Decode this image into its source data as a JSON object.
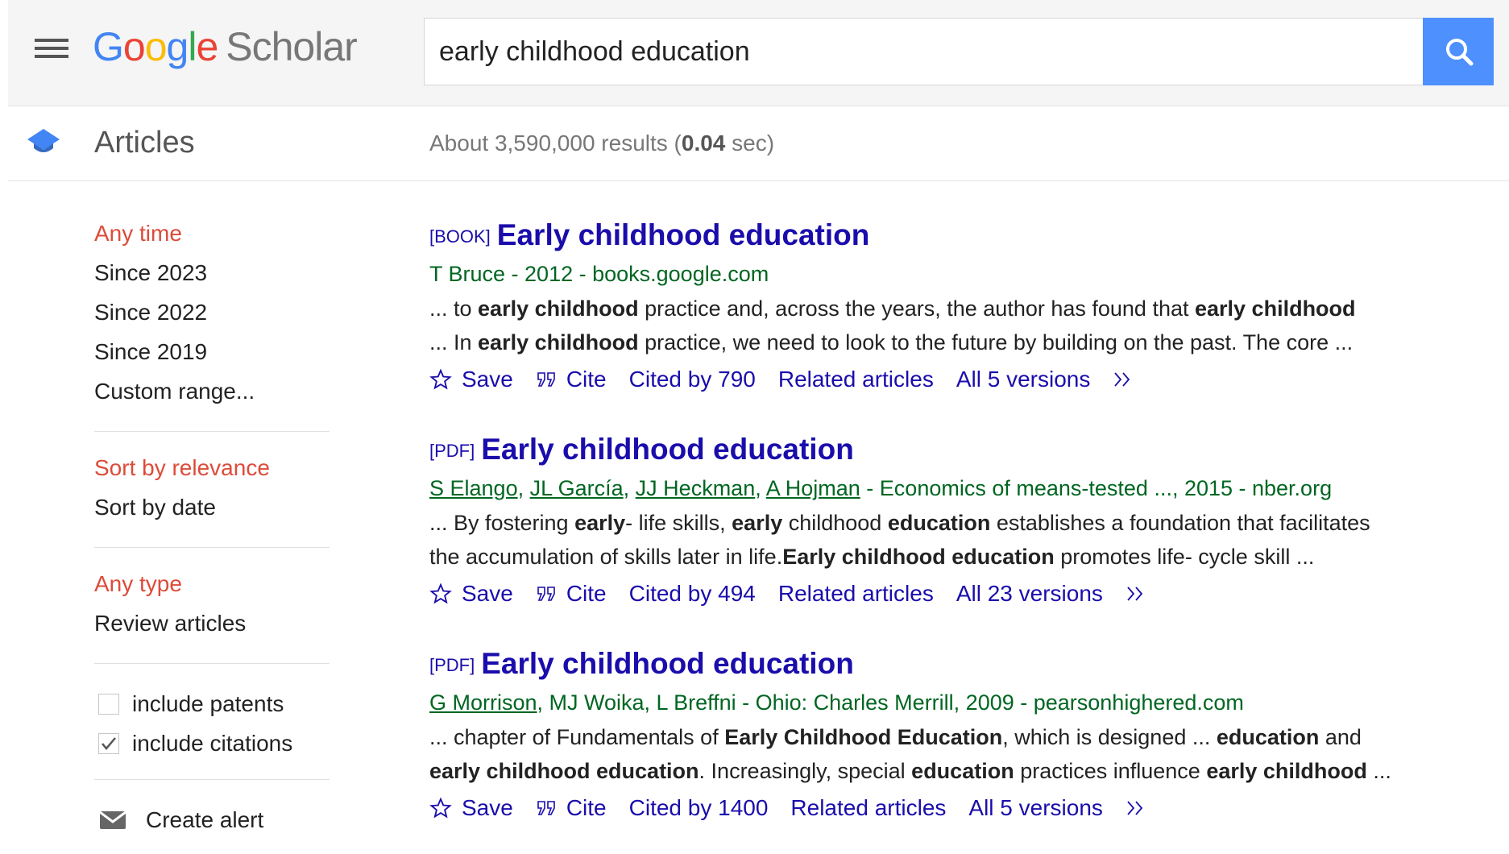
{
  "header": {
    "logo_scholar": "Scholar",
    "search_query": "early childhood education"
  },
  "articles_bar": {
    "label": "Articles",
    "stats_prefix": "About 3,590,000 results (",
    "stats_time": "0.04",
    "stats_suffix": " sec)"
  },
  "sidebar": {
    "time": [
      "Any time",
      "Since 2023",
      "Since 2022",
      "Since 2019",
      "Custom range..."
    ],
    "sort": [
      "Sort by relevance",
      "Sort by date"
    ],
    "type": [
      "Any type",
      "Review articles"
    ],
    "include_patents": "include patents",
    "include_citations": "include citations",
    "create_alert": "Create alert"
  },
  "results": [
    {
      "tag": "[BOOK]",
      "title": "Early childhood education",
      "authors_tail": "T Bruce - 2012 - books.google.com",
      "actions": {
        "save": "Save",
        "cite": "Cite",
        "cited_by": "Cited by 790",
        "related": "Related articles",
        "versions": "All 5 versions"
      }
    },
    {
      "tag": "[PDF]",
      "title": "Early childhood education",
      "author_links": [
        "S Elango",
        "JL García",
        "JJ Heckman",
        "A Hojman"
      ],
      "authors_tail": " - Economics of means-tested ..., 2015 - nber.org",
      "actions": {
        "save": "Save",
        "cite": "Cite",
        "cited_by": "Cited by 494",
        "related": "Related articles",
        "versions": "All 23 versions"
      }
    },
    {
      "tag": "[PDF]",
      "title": "Early childhood education",
      "author_links": [
        "G Morrison"
      ],
      "authors_tail": ", MJ Woika, L Breffni - Ohio: Charles Merrill, 2009 - pearsonhighered.com",
      "actions": {
        "save": "Save",
        "cite": "Cite",
        "cited_by": "Cited by 1400",
        "related": "Related articles",
        "versions": "All 5 versions"
      }
    }
  ],
  "snippets": {
    "r0_l1": [
      "... to ",
      "early childhood",
      " practice and, across the years, the author has found that ",
      "early childhood"
    ],
    "r0_l2": [
      "... In ",
      "early childhood",
      " practice, we need to look to the future by building on the past. The core ..."
    ],
    "r1_l1": [
      "... By fostering ",
      "early",
      "- life skills, ",
      "early",
      " childhood ",
      "education",
      " establishes a foundation that facilitates"
    ],
    "r1_l2": [
      "the accumulation of skills later in life.",
      "Early childhood education",
      " promotes life- cycle skill ..."
    ],
    "r2_l1": [
      "... chapter of Fundamentals of ",
      "Early Childhood Education",
      ", which is designed ... ",
      "education",
      " and"
    ],
    "r2_l2": [
      "early childhood education",
      ". Increasingly, special ",
      "education",
      " practices influence ",
      "early childhood",
      " ..."
    ]
  },
  "colors": {
    "link": "#1a0dab",
    "authors_green": "#006621",
    "active_red": "#dd4b39",
    "search_blue": "#4d90fe"
  }
}
